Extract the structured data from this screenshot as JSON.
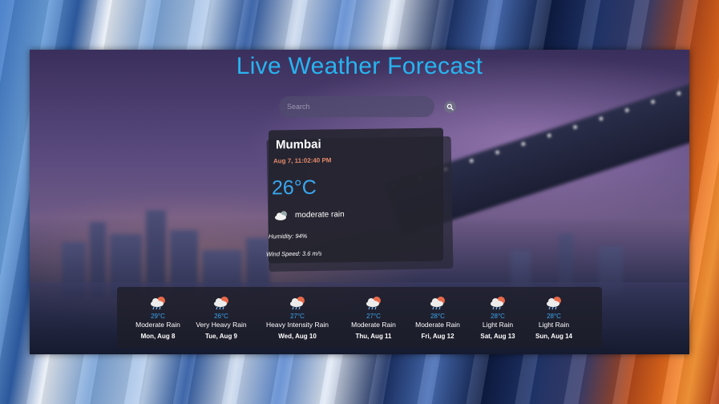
{
  "header": {
    "title": "Live Weather Forecast"
  },
  "search": {
    "placeholder": "Search",
    "icon": "search-icon"
  },
  "current": {
    "city": "Mumbai",
    "datetime": "Aug 7, 11:02:40 PM",
    "temperature": "26°C",
    "condition": "moderate rain",
    "condition_icon": "cloud-icon",
    "humidity": "Humidity: 94%",
    "wind_speed": "Wind Speed: 3.6 m/s"
  },
  "forecast": [
    {
      "temp": "29°C",
      "desc": "Moderate Rain",
      "date": "Mon, Aug 8",
      "icon": "rain-sun-icon"
    },
    {
      "temp": "26°C",
      "desc": "Very Heavy Rain",
      "date": "Tue, Aug 9",
      "icon": "rain-sun-icon"
    },
    {
      "temp": "27°C",
      "desc": "Heavy Intensity Rain",
      "date": "Wed, Aug 10",
      "icon": "rain-sun-icon"
    },
    {
      "temp": "27°C",
      "desc": "Moderate Rain",
      "date": "Thu, Aug 11",
      "icon": "rain-sun-icon"
    },
    {
      "temp": "28°C",
      "desc": "Moderate Rain",
      "date": "Fri, Aug 12",
      "icon": "rain-sun-icon"
    },
    {
      "temp": "28°C",
      "desc": "Light Rain",
      "date": "Sat, Aug 13",
      "icon": "rain-sun-icon"
    },
    {
      "temp": "28°C",
      "desc": "Light Rain",
      "date": "Sun, Aug 14",
      "icon": "rain-sun-icon"
    }
  ],
  "colors": {
    "title": "#27b4f0",
    "temperature": "#3aa6ee",
    "datetime": "#e4896a"
  }
}
